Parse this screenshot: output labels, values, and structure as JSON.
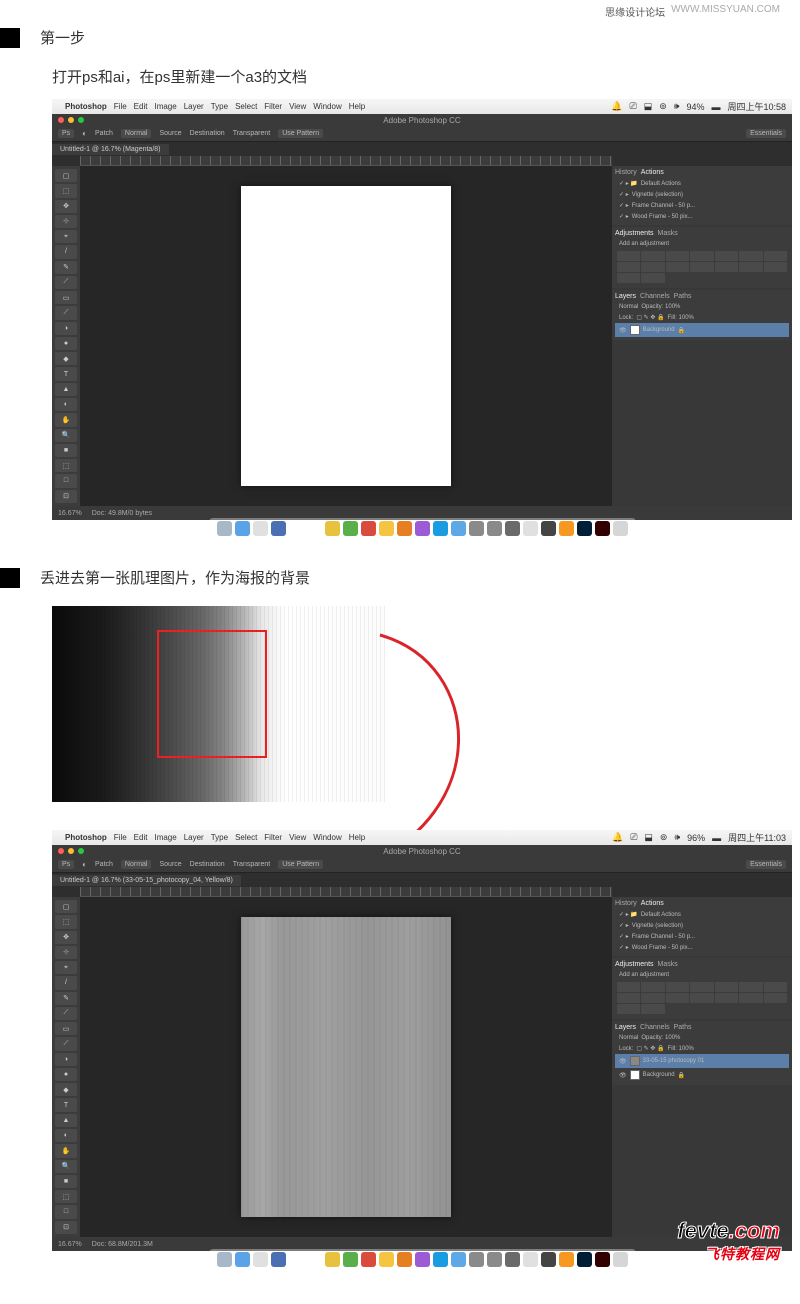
{
  "header": {
    "brand": "思缘设计论坛",
    "url": "WWW.MISSYUAN.COM"
  },
  "step1": {
    "title": "第一步",
    "instruction": "打开ps和ai，在ps里新建一个a3的文档"
  },
  "step2": {
    "instruction": "丢进去第一张肌理图片，作为海报的背景"
  },
  "mac_menu": {
    "items": [
      "Photoshop",
      "File",
      "Edit",
      "Image",
      "Layer",
      "Type",
      "Select",
      "Filter",
      "View",
      "Window",
      "Help"
    ],
    "battery": "94%",
    "time1": "周四上午10:58",
    "battery2": "96%",
    "time2": "周四上午11:03"
  },
  "ps": {
    "title": "Adobe Photoshop CC",
    "tab1": "Untitled-1 @ 16.7% (Magenta/8)",
    "tab2": "Untitled-1 @ 16.7% (33-05-15_photocopy_04, Yellow/8)",
    "options": {
      "tool": "Patch",
      "mode": "Normal",
      "src": "Source",
      "dst": "Destination",
      "trans": "Transparent",
      "use": "Use Pattern"
    },
    "zoom": "16.67%",
    "docsize1": "Doc: 49.8M/0 bytes",
    "docsize2": "Doc: 68.8M/201.3M",
    "panels": {
      "history_tab": "History",
      "actions_tab": "Actions",
      "actions": [
        "Default Actions",
        "Vignette (selection)",
        "Frame Channel - 50 p...",
        "Wood Frame - 50 pix..."
      ],
      "adj_tab": "Adjustments",
      "masks_tab": "Masks",
      "adj_label": "Add an adjustment",
      "layers_tab": "Layers",
      "channels_tab": "Channels",
      "paths_tab": "Paths",
      "blend": "Normal",
      "opacity": "Opacity: 100%",
      "lock": "Lock:",
      "fill": "Fill: 100%",
      "bg_layer": "Background",
      "tex_layer": "33-05-15 photocopy 01",
      "bg_layer2": "Background"
    },
    "workspace_label": "Essentials"
  },
  "dock_colors": [
    "#a9b8c9",
    "#5aa3e6",
    "#e0e0e0",
    "#4a6fb3",
    "#fff",
    "#fff",
    "#e6c23e",
    "#5baf4a",
    "#d94b3c",
    "#f5c542",
    "#e67e22",
    "#9c5bd4",
    "#199de0",
    "#5fa8e6",
    "#8a8a8a",
    "#8a8a8a",
    "#6a6a6a",
    "#e0e0e0",
    "#444",
    "#f79921",
    "#001e36",
    "#330000",
    "#d6d6d6"
  ],
  "tools_glyphs": [
    "▢",
    "⬚",
    "✥",
    "⊹",
    "⌖",
    "/",
    "✎",
    "⟋",
    "▭",
    "⟋",
    "◑",
    "●",
    "◆",
    "T",
    "▲",
    "◐",
    "✋",
    "🔍",
    "■",
    "⬚",
    "□",
    "⊡"
  ],
  "watermark": {
    "line1a": "fevte",
    "line1b": ".com",
    "line2": "飞特教程网"
  }
}
